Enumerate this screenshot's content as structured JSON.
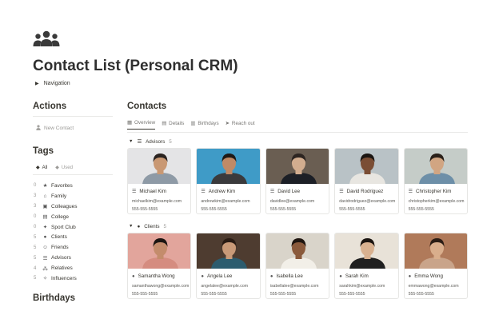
{
  "page": {
    "icon": "people-group-icon",
    "title": "Contact List (Personal CRM)",
    "navigation_label": "Navigation"
  },
  "actions": {
    "heading": "Actions",
    "new_contact_label": "New Contact"
  },
  "tags": {
    "heading": "Tags",
    "filter_tabs": [
      {
        "label": "All",
        "icon": "tag-icon",
        "active": true
      },
      {
        "label": "Used",
        "icon": "tag-icon",
        "active": false
      }
    ],
    "items": [
      {
        "count": "0",
        "icon": "star-icon",
        "label": "Favorites"
      },
      {
        "count": "3",
        "icon": "home-icon",
        "label": "Family"
      },
      {
        "count": "3",
        "icon": "briefcase-icon",
        "label": "Colleagues"
      },
      {
        "count": "0",
        "icon": "college-icon",
        "label": "College"
      },
      {
        "count": "0",
        "icon": "running-icon",
        "label": "Sport Club"
      },
      {
        "count": "5",
        "icon": "client-icon",
        "label": "Clients"
      },
      {
        "count": "5",
        "icon": "smile-icon",
        "label": "Friends"
      },
      {
        "count": "5",
        "icon": "list-icon",
        "label": "Advisors"
      },
      {
        "count": "4",
        "icon": "family-tree-icon",
        "label": "Relatives"
      },
      {
        "count": "5",
        "icon": "sparkle-icon",
        "label": "Influencers"
      }
    ]
  },
  "birthdays": {
    "heading": "Birthdays"
  },
  "contacts": {
    "heading": "Contacts",
    "view_tabs": [
      {
        "label": "Overview",
        "icon": "grid-icon",
        "active": true
      },
      {
        "label": "Details",
        "icon": "table-icon",
        "active": false
      },
      {
        "label": "Birthdays",
        "icon": "calendar-icon",
        "active": false
      },
      {
        "label": "Reach out",
        "icon": "send-icon",
        "active": false
      }
    ],
    "groups": [
      {
        "name": "Advisors",
        "count": "5",
        "icon": "list-icon",
        "cards": [
          {
            "name": "Michael Kim",
            "email": "michaelkim@example.com",
            "phone": "555-555-5555",
            "photo": {
              "bg": "#e4e4e6",
              "skin": "#c99873",
              "hair": "#2a2320",
              "shirt": "#8e9aa6"
            }
          },
          {
            "name": "Andrew Kim",
            "email": "andrewkim@example.com",
            "phone": "555-555-5555",
            "photo": {
              "bg": "#3f9bc7",
              "skin": "#c08a66",
              "hair": "#1f1a17",
              "shirt": "#3a3a3c"
            }
          },
          {
            "name": "David Lee",
            "email": "davidlee@example.com",
            "phone": "555-555-5555",
            "photo": {
              "bg": "#6a5e52",
              "skin": "#d2ad8f",
              "hair": "#2d2521",
              "shirt": "#1c1f26"
            }
          },
          {
            "name": "David Rodriguez",
            "email": "davidrodriguez@example.com",
            "phone": "555-555-5555",
            "photo": {
              "bg": "#b9c2c6",
              "skin": "#7a4d34",
              "hair": "#1a1411",
              "shirt": "#e8e6e1"
            }
          },
          {
            "name": "Christopher Kim",
            "email": "christopherkim@example.com",
            "phone": "555-555-5555",
            "photo": {
              "bg": "#c5ccc8",
              "skin": "#d1a582",
              "hair": "#2a2019",
              "shirt": "#6d8fa8"
            }
          }
        ]
      },
      {
        "name": "Clients",
        "count": "5",
        "icon": "client-icon",
        "cards": [
          {
            "name": "Samantha Wong",
            "email": "samanthawong@example.com",
            "phone": "555-555-5555",
            "photo": {
              "bg": "#e2a59c",
              "skin": "#c48c6c",
              "hair": "#1c1512",
              "shirt": "#d58c80"
            }
          },
          {
            "name": "Angela Lee",
            "email": "angelalee@example.com",
            "phone": "555-555-5555",
            "photo": {
              "bg": "#4e3c30",
              "skin": "#c99a78",
              "hair": "#2a1c14",
              "shirt": "#2c5c6e"
            }
          },
          {
            "name": "Isabella Lee",
            "email": "isabellalee@example.com",
            "phone": "555-555-5555",
            "photo": {
              "bg": "#d9d4ca",
              "skin": "#8a5a3c",
              "hair": "#1e1510",
              "shirt": "#f2efe8"
            }
          },
          {
            "name": "Sarah Kim",
            "email": "sarahkim@example.com",
            "phone": "555-555-5555",
            "photo": {
              "bg": "#e8e2d8",
              "skin": "#d8b190",
              "hair": "#1a1410",
              "shirt": "#1f1f1f"
            }
          },
          {
            "name": "Emma Wong",
            "email": "emmawong@example.com",
            "phone": "555-555-5555",
            "photo": {
              "bg": "#b07a5a",
              "skin": "#d9ae8c",
              "hair": "#2b1d15",
              "shirt": "#c9a48a"
            }
          }
        ]
      }
    ]
  }
}
